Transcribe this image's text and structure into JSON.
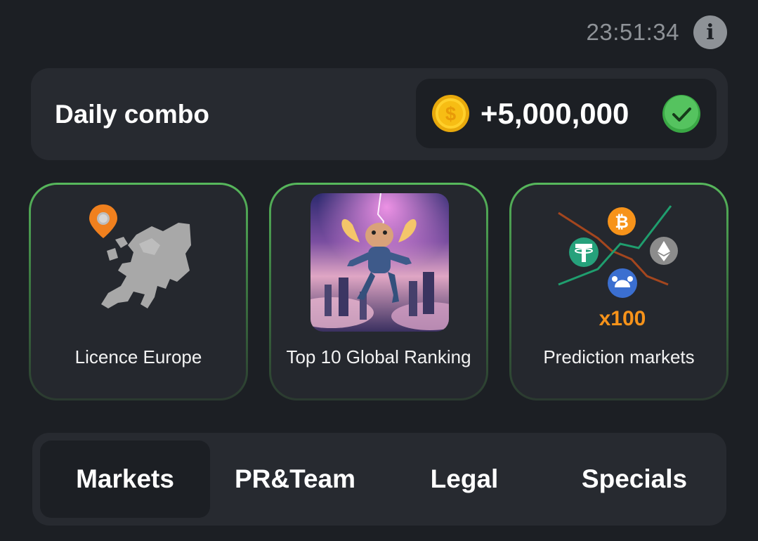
{
  "header": {
    "time": "23:51:34",
    "info_icon": "info-icon"
  },
  "daily_combo": {
    "title": "Daily combo",
    "reward": "+5,000,000",
    "coin_symbol": "$",
    "completed": true
  },
  "cards": [
    {
      "label": "Licence Europe",
      "icon": "europe-map-icon"
    },
    {
      "label": "Top 10 Global Ranking",
      "icon": "hamster-astronaut-image"
    },
    {
      "label": "Prediction markets",
      "icon": "prediction-chart-icon",
      "multiplier": "x100"
    }
  ],
  "tabs": [
    {
      "label": "Markets",
      "active": true
    },
    {
      "label": "PR&Team",
      "active": false
    },
    {
      "label": "Legal",
      "active": false
    },
    {
      "label": "Specials",
      "active": false
    }
  ],
  "colors": {
    "accent_green": "#57b85c",
    "background": "#1c1f24",
    "panel": "#272a30",
    "orange": "#f7931a"
  }
}
